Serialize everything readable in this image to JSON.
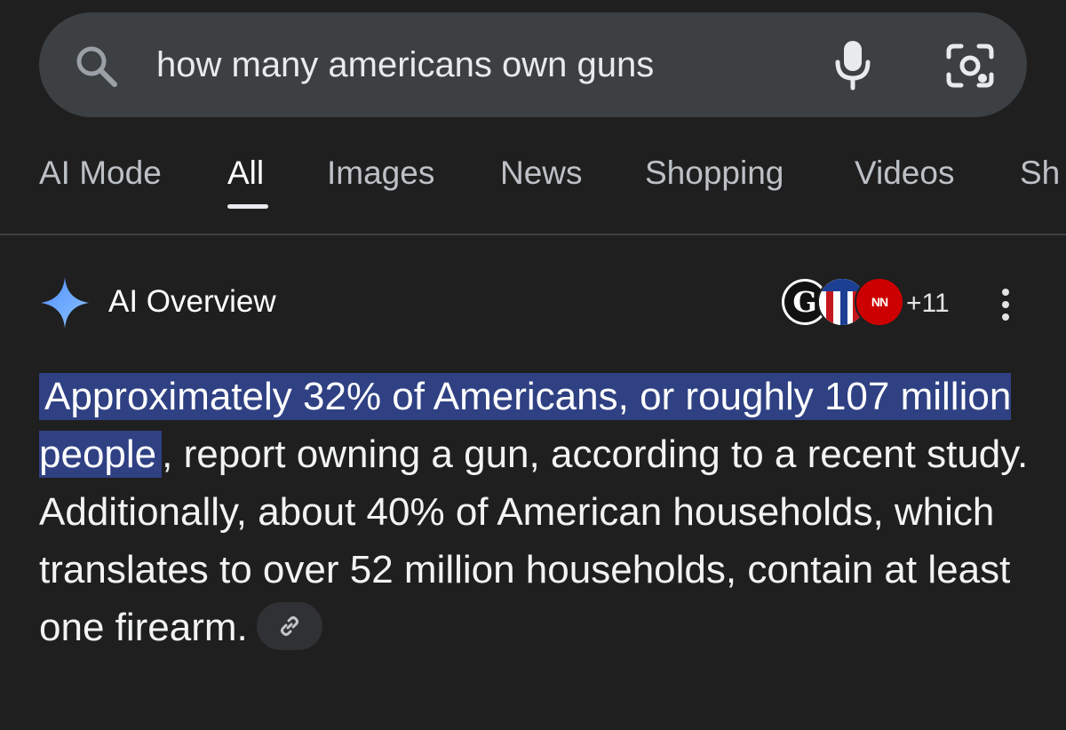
{
  "search": {
    "query": "how many americans own guns"
  },
  "tabs": [
    {
      "label": "AI Mode"
    },
    {
      "label": "All"
    },
    {
      "label": "Images"
    },
    {
      "label": "News"
    },
    {
      "label": "Shopping"
    },
    {
      "label": "Videos"
    },
    {
      "label": "Sh"
    }
  ],
  "active_tab": "All",
  "ai_overview": {
    "title": "AI Overview",
    "sources": {
      "favicon_g_letter": "G",
      "favicon_cnn_text": "NN",
      "more_count": "+11"
    },
    "answer_highlighted": "Approximately 32% of Americans, or roughly 107 million people",
    "answer_rest": ", report owning a gun, according to a recent study. Additionally, about 40% of American households, which translates to over 52 million households, contain at least one firearm.",
    "link_icon": "link-icon"
  },
  "colors": {
    "background": "#1f1f1f",
    "search_bar": "#3c4043",
    "highlight": "#2f4183",
    "sparkle_blue": "#6fa8ff"
  },
  "icons": [
    "search-icon",
    "mic-icon",
    "google-lens-icon",
    "sparkle-icon",
    "kebab-menu-icon",
    "link-icon"
  ]
}
